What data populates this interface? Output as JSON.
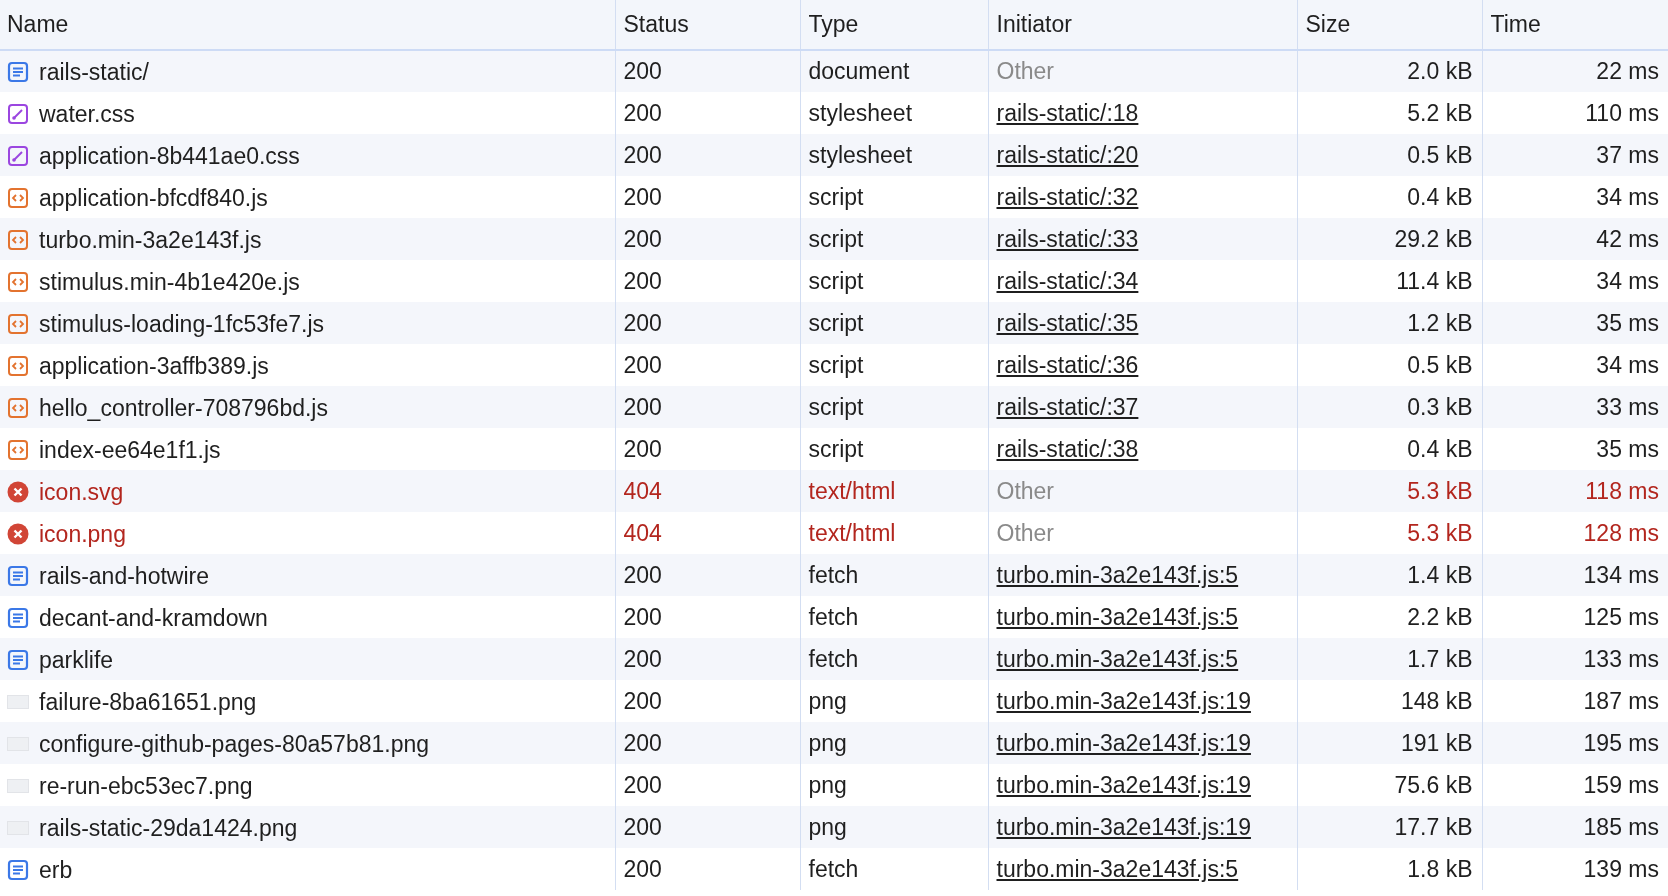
{
  "table": {
    "columns": [
      "Name",
      "Status",
      "Type",
      "Initiator",
      "Size",
      "Time"
    ],
    "rows": [
      {
        "kind": "document",
        "failed": false,
        "name": "rails-static/",
        "status": "200",
        "type": "document",
        "initiator": "Other",
        "initiator_link": false,
        "size": "2.0 kB",
        "time": "22 ms"
      },
      {
        "kind": "stylesheet",
        "failed": false,
        "name": "water.css",
        "status": "200",
        "type": "stylesheet",
        "initiator": "rails-static/:18",
        "initiator_link": true,
        "size": "5.2 kB",
        "time": "110 ms"
      },
      {
        "kind": "stylesheet",
        "failed": false,
        "name": "application-8b441ae0.css",
        "status": "200",
        "type": "stylesheet",
        "initiator": "rails-static/:20",
        "initiator_link": true,
        "size": "0.5 kB",
        "time": "37 ms"
      },
      {
        "kind": "script",
        "failed": false,
        "name": "application-bfcdf840.js",
        "status": "200",
        "type": "script",
        "initiator": "rails-static/:32",
        "initiator_link": true,
        "size": "0.4 kB",
        "time": "34 ms"
      },
      {
        "kind": "script",
        "failed": false,
        "name": "turbo.min-3a2e143f.js",
        "status": "200",
        "type": "script",
        "initiator": "rails-static/:33",
        "initiator_link": true,
        "size": "29.2 kB",
        "time": "42 ms"
      },
      {
        "kind": "script",
        "failed": false,
        "name": "stimulus.min-4b1e420e.js",
        "status": "200",
        "type": "script",
        "initiator": "rails-static/:34",
        "initiator_link": true,
        "size": "11.4 kB",
        "time": "34 ms"
      },
      {
        "kind": "script",
        "failed": false,
        "name": "stimulus-loading-1fc53fe7.js",
        "status": "200",
        "type": "script",
        "initiator": "rails-static/:35",
        "initiator_link": true,
        "size": "1.2 kB",
        "time": "35 ms"
      },
      {
        "kind": "script",
        "failed": false,
        "name": "application-3affb389.js",
        "status": "200",
        "type": "script",
        "initiator": "rails-static/:36",
        "initiator_link": true,
        "size": "0.5 kB",
        "time": "34 ms"
      },
      {
        "kind": "script",
        "failed": false,
        "name": "hello_controller-708796bd.js",
        "status": "200",
        "type": "script",
        "initiator": "rails-static/:37",
        "initiator_link": true,
        "size": "0.3 kB",
        "time": "33 ms"
      },
      {
        "kind": "script",
        "failed": false,
        "name": "index-ee64e1f1.js",
        "status": "200",
        "type": "script",
        "initiator": "rails-static/:38",
        "initiator_link": true,
        "size": "0.4 kB",
        "time": "35 ms"
      },
      {
        "kind": "error",
        "failed": true,
        "name": "icon.svg",
        "status": "404",
        "type": "text/html",
        "initiator": "Other",
        "initiator_link": false,
        "size": "5.3 kB",
        "time": "118 ms"
      },
      {
        "kind": "error",
        "failed": true,
        "name": "icon.png",
        "status": "404",
        "type": "text/html",
        "initiator": "Other",
        "initiator_link": false,
        "size": "5.3 kB",
        "time": "128 ms"
      },
      {
        "kind": "document",
        "failed": false,
        "name": "rails-and-hotwire",
        "status": "200",
        "type": "fetch",
        "initiator": "turbo.min-3a2e143f.js:5",
        "initiator_link": true,
        "size": "1.4 kB",
        "time": "134 ms"
      },
      {
        "kind": "document",
        "failed": false,
        "name": "decant-and-kramdown",
        "status": "200",
        "type": "fetch",
        "initiator": "turbo.min-3a2e143f.js:5",
        "initiator_link": true,
        "size": "2.2 kB",
        "time": "125 ms"
      },
      {
        "kind": "document",
        "failed": false,
        "name": "parklife",
        "status": "200",
        "type": "fetch",
        "initiator": "turbo.min-3a2e143f.js:5",
        "initiator_link": true,
        "size": "1.7 kB",
        "time": "133 ms"
      },
      {
        "kind": "image",
        "failed": false,
        "name": "failure-8ba61651.png",
        "status": "200",
        "type": "png",
        "initiator": "turbo.min-3a2e143f.js:19",
        "initiator_link": true,
        "size": "148 kB",
        "time": "187 ms"
      },
      {
        "kind": "image",
        "failed": false,
        "name": "configure-github-pages-80a57b81.png",
        "status": "200",
        "type": "png",
        "initiator": "turbo.min-3a2e143f.js:19",
        "initiator_link": true,
        "size": "191 kB",
        "time": "195 ms"
      },
      {
        "kind": "image",
        "failed": false,
        "name": "re-run-ebc53ec7.png",
        "status": "200",
        "type": "png",
        "initiator": "turbo.min-3a2e143f.js:19",
        "initiator_link": true,
        "size": "75.6 kB",
        "time": "159 ms"
      },
      {
        "kind": "image",
        "failed": false,
        "name": "rails-static-29da1424.png",
        "status": "200",
        "type": "png",
        "initiator": "turbo.min-3a2e143f.js:19",
        "initiator_link": true,
        "size": "17.7 kB",
        "time": "185 ms"
      },
      {
        "kind": "document",
        "failed": false,
        "name": "erb",
        "status": "200",
        "type": "fetch",
        "initiator": "turbo.min-3a2e143f.js:5",
        "initiator_link": true,
        "size": "1.8 kB",
        "time": "139 ms"
      }
    ]
  }
}
